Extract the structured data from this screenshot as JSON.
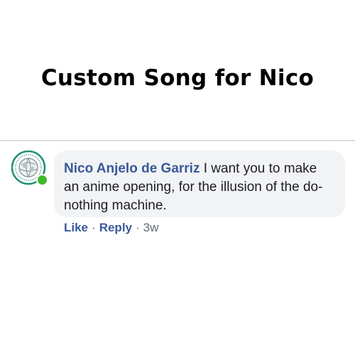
{
  "headline": "Custom Song for Nico",
  "comment": {
    "author": "Nico Anjelo de Garriz",
    "text": "I want you to make an anime opening, for the illusion of the do-nothing machine.",
    "online": true,
    "avatar_icon": "globe-badge-logo",
    "colors": {
      "author": "#385898",
      "bubble": "#f2f3f5",
      "online": "#42b72a",
      "avatar_ring": "#1e8f72"
    }
  },
  "actions": {
    "like": "Like",
    "reply": "Reply",
    "separator": "·",
    "time": "3w"
  }
}
